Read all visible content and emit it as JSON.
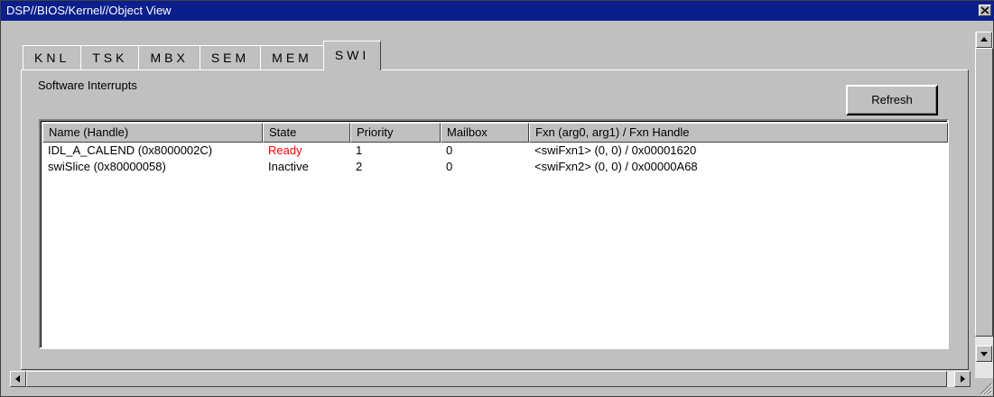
{
  "window": {
    "title": "DSP//BIOS/Kernel//Object View"
  },
  "tabs": [
    {
      "label": "KNL"
    },
    {
      "label": "TSK"
    },
    {
      "label": "MBX"
    },
    {
      "label": "SEM"
    },
    {
      "label": "MEM"
    },
    {
      "label": "SWI",
      "active": true
    }
  ],
  "panel": {
    "title": "Software Interrupts",
    "refresh_label": "Refresh"
  },
  "table": {
    "headers": [
      "Name (Handle)",
      "State",
      "Priority",
      "Mailbox",
      "Fxn (arg0, arg1)  /  Fxn Handle"
    ],
    "rows": [
      {
        "name": "IDL_A_CALEND  (0x8000002C)",
        "state": "Ready",
        "priority": "1",
        "mailbox": "0",
        "fxn": "<swiFxn1> (0, 0)  /  0x00001620"
      },
      {
        "name": "swiSlice  (0x80000058)",
        "state": "Inactive",
        "priority": "2",
        "mailbox": "0",
        "fxn": "<swiFxn2> (0, 0)  /  0x00000A68"
      }
    ]
  },
  "colors": {
    "titlebar": "#0a1f8c",
    "ready_state": "#ff0000",
    "face": "#c0c0c0"
  },
  "icons": {
    "close": "close-icon",
    "up": "arrow-up-icon",
    "down": "arrow-down-icon",
    "left": "arrow-left-icon",
    "right": "arrow-right-icon"
  }
}
